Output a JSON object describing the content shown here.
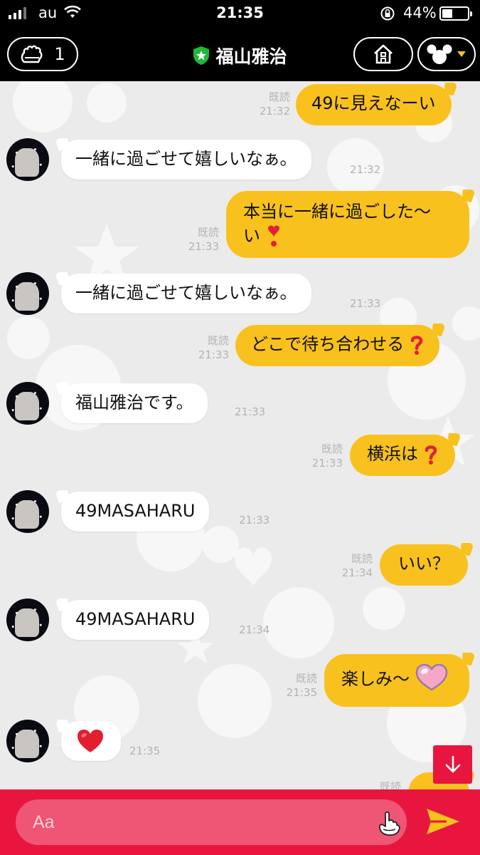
{
  "status_bar": {
    "carrier": "au",
    "time": "21:35",
    "battery": "44%",
    "battery_level": 0.44
  },
  "header": {
    "count": "1",
    "title": "福山雅治",
    "back_icon": "glove-hand-icon",
    "home_icon": "house-icon",
    "menu_icon": "mickey-icon"
  },
  "messages": [
    {
      "dir": "out",
      "text": "49に見えなーい",
      "read": "既読",
      "time": "21:32"
    },
    {
      "dir": "in",
      "text": "一緒に過ごせて嬉しいなぁ。",
      "time": "21:32"
    },
    {
      "dir": "out",
      "line1": "本当に一緒に過ごした〜",
      "line2": "い",
      "read": "既読",
      "time": "21:33"
    },
    {
      "dir": "in",
      "text": "一緒に過ごせて嬉しいなぁ。",
      "time": "21:33"
    },
    {
      "dir": "out",
      "text": "どこで待ち合わせる",
      "read": "既読",
      "time": "21:33"
    },
    {
      "dir": "in",
      "text": "福山雅治です。",
      "time": "21:33"
    },
    {
      "dir": "out",
      "text": "横浜は",
      "read": "既読",
      "time": "21:33"
    },
    {
      "dir": "in",
      "text": "49MASAHARU",
      "time": "21:33"
    },
    {
      "dir": "out",
      "text": "いい？",
      "read": "既読",
      "time": "21:34"
    },
    {
      "dir": "in",
      "text": "49MASAHARU",
      "time": "21:34"
    },
    {
      "dir": "out",
      "text": "楽しみ〜",
      "read": "既読",
      "time": "21:35"
    },
    {
      "dir": "in",
      "text": "",
      "time": "21:35"
    },
    {
      "dir": "out",
      "text": "",
      "read": "既読"
    }
  ],
  "input": {
    "placeholder": "Aa"
  },
  "colors": {
    "accent": "#e8163f",
    "outgoing": "#f9c11d",
    "background": "#ebebeb"
  }
}
